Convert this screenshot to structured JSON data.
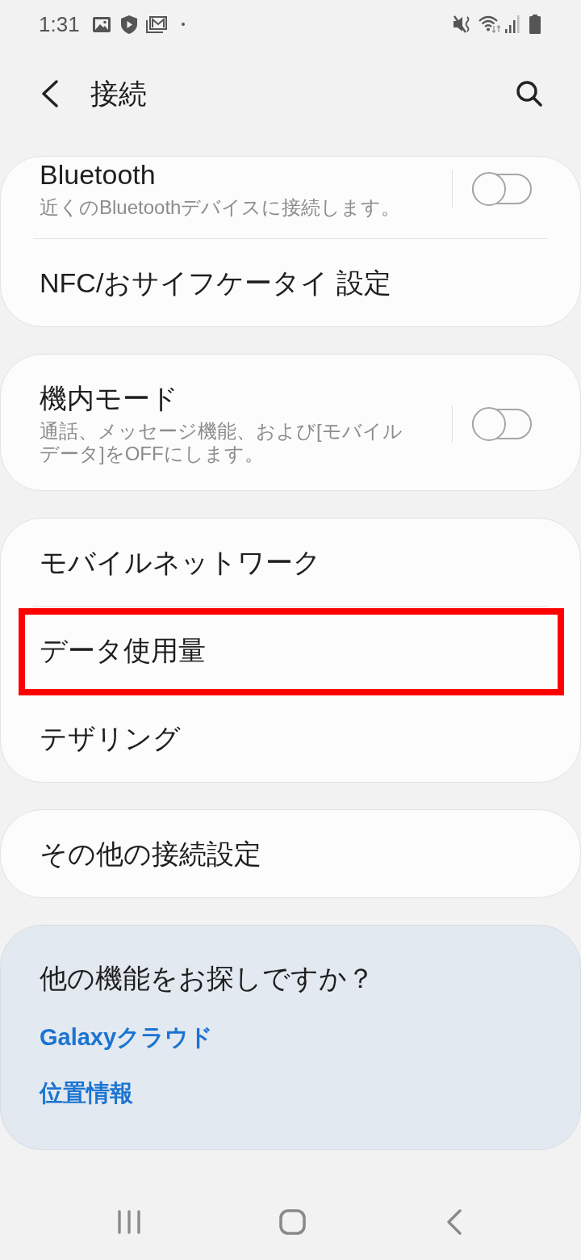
{
  "status_bar": {
    "time": "1:31"
  },
  "header": {
    "title": "接続"
  },
  "groups": [
    {
      "items": [
        {
          "kind": "toggle",
          "title": "Bluetooth",
          "subtitle": "近くのBluetoothデバイスに接続します。",
          "on": false,
          "highlighted": false
        },
        {
          "kind": "link",
          "title": "NFC/おサイフケータイ 設定",
          "highlighted": false
        }
      ]
    },
    {
      "items": [
        {
          "kind": "toggle",
          "title": "機内モード",
          "subtitle": "通話、メッセージ機能、および[モバイルデータ]をOFFにします。",
          "on": false,
          "highlighted": false
        }
      ]
    },
    {
      "items": [
        {
          "kind": "link",
          "title": "モバイルネットワーク",
          "highlighted": false
        },
        {
          "kind": "link",
          "title": "データ使用量",
          "highlighted": true
        },
        {
          "kind": "link",
          "title": "テザリング",
          "highlighted": false
        }
      ]
    },
    {
      "items": [
        {
          "kind": "link",
          "title": "その他の接続設定",
          "highlighted": false
        }
      ]
    }
  ],
  "suggestions": {
    "title": "他の機能をお探しですか？",
    "links": [
      "Galaxyクラウド",
      "位置情報"
    ]
  }
}
